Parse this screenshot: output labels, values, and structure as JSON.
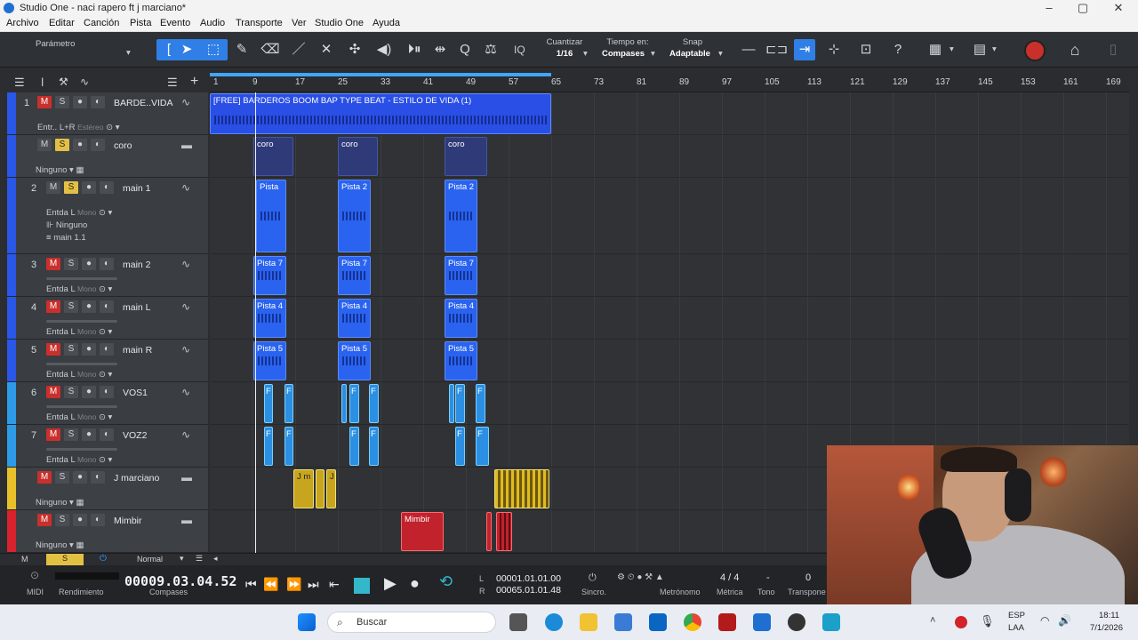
{
  "window": {
    "title": "Studio One - naci rapero ft j marciano*"
  },
  "menu": [
    "Archivo",
    "Editar",
    "Canción",
    "Pista",
    "Evento",
    "Audio",
    "Transporte",
    "Ver",
    "Studio One",
    "Ayuda"
  ],
  "toolbar": {
    "parameter_label": "Parámetro",
    "iq_label": "IQ",
    "quantize_label": "Cuantizar",
    "quantize_value": "1/16",
    "timebase_label": "Tiempo en:",
    "timebase_value": "Compases",
    "snap_label": "Snap",
    "snap_value": "Adaptable"
  },
  "ruler": {
    "ticks": [
      "1",
      "9",
      "17",
      "25",
      "33",
      "41",
      "49",
      "57",
      "65",
      "73",
      "81",
      "89",
      "97",
      "105",
      "113",
      "121",
      "129",
      "137",
      "145",
      "153",
      "161",
      "169"
    ]
  },
  "tracks": [
    {
      "num": "1",
      "name": "BARDE..VIDA",
      "input": "Entr.. L+R",
      "mode": "Estéreo",
      "color": "#2a57e8"
    },
    {
      "num": "",
      "name": "coro",
      "input": "Ninguno",
      "mode": "",
      "color": "#2a57e8"
    },
    {
      "num": "2",
      "name": "main 1",
      "input": "Entda L",
      "mode": "Mono",
      "output": "Ninguno",
      "extra": "main 1.1",
      "color": "#2a57e8"
    },
    {
      "num": "3",
      "name": "main 2",
      "input": "Entda L",
      "mode": "Mono",
      "color": "#2a57e8"
    },
    {
      "num": "4",
      "name": "main L",
      "input": "Entda L",
      "mode": "Mono",
      "color": "#2a57e8"
    },
    {
      "num": "5",
      "name": "main R",
      "input": "Entda L",
      "mode": "Mono",
      "color": "#2a57e8"
    },
    {
      "num": "6",
      "name": "VOS1",
      "input": "Entda L",
      "mode": "Mono",
      "color": "#2d9be8"
    },
    {
      "num": "7",
      "name": "VOZ2",
      "input": "Entda L",
      "mode": "Mono",
      "color": "#2d9be8"
    },
    {
      "num": "",
      "name": "J marciano",
      "input": "Ninguno",
      "mode": "",
      "color": "#e8c12a"
    },
    {
      "num": "",
      "name": "Mimbir",
      "input": "Ninguno",
      "mode": "",
      "color": "#d8232f"
    }
  ],
  "clips": {
    "beat": "[FREE] BARDEROS BOOM BAP TYPE BEAT - ESTILO DE VIDA (1)",
    "coro": "coro",
    "pista": "Pista",
    "pista2": "Pista 2",
    "pista7": "Pista 7",
    "pista4": "Pista 4",
    "pista5": "Pista 5",
    "jm": "J m",
    "j": "J",
    "mimbir": "Mimbir",
    "f": "F"
  },
  "footer": {
    "m": "M",
    "s": "S",
    "mode": "Normal"
  },
  "transport": {
    "midi": "MIDI",
    "performance": "Rendimiento",
    "time": "00009.03.04.52",
    "time_unit": "Compases",
    "l_label": "L",
    "r_label": "R",
    "left_locator": "00001.01.01.00",
    "right_locator": "00065.01.01.48",
    "sync": "Sincro.",
    "metronome": "Metrónomo",
    "meter_value": "4 / 4",
    "meter": "Métrica",
    "tone_value": "-",
    "tone": "Tono",
    "transpose_value": "0",
    "transpose": "Transpone"
  },
  "taskbar": {
    "search": "Buscar",
    "lang1": "ESP",
    "lang2": "LAA",
    "time": "18:11",
    "date": "7/1/2026"
  }
}
